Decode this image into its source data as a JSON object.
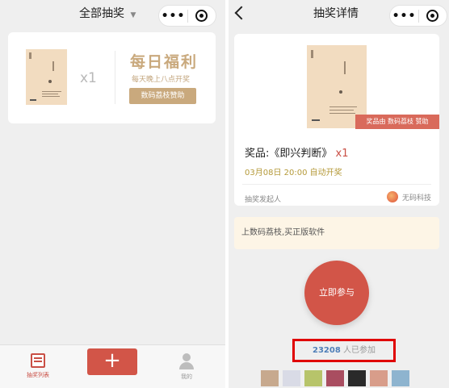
{
  "left": {
    "title": "全部抽奖",
    "card": {
      "multiplier": "x1",
      "title": "每日福利",
      "subtitle": "每天晚上八点开奖",
      "sponsor_button": "数码荔枝赞助"
    },
    "tabbar": {
      "list_label": "抽奖列表",
      "add_label": "+",
      "me_label": "我的"
    }
  },
  "right": {
    "title": "抽奖详情",
    "prize_ribbon": "奖品由 数码荔枝 赞助",
    "prize_label": "奖品:《即兴判断》",
    "prize_multiplier": "x1",
    "draw_time": "03月08日 20:00 自动开奖",
    "host_label": "抽奖发起人",
    "host_name": "无码科技",
    "notice": "上数码荔枝,买正版软件",
    "join_button": "立即参与",
    "participants_count": "23208",
    "participants_suffix": "人已参加"
  },
  "colors": {
    "accent_red": "#d25548",
    "gold": "#c9a97d",
    "highlight_box": "#e00000",
    "count_blue": "#4f7fb8"
  }
}
